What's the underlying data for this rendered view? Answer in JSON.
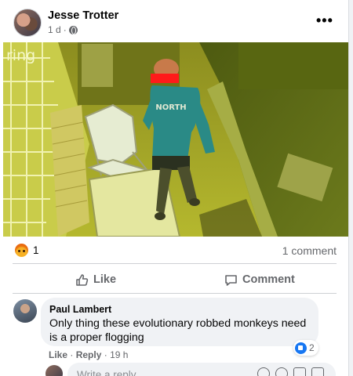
{
  "post": {
    "author": "Jesse Trotter",
    "time": "1 d",
    "separator": "·",
    "privacy_icon": "globe-icon",
    "more_icon": "more-options-icon",
    "more_label": "•••"
  },
  "photo": {
    "watermark": "ring",
    "jacket_text": "NORTH"
  },
  "stats": {
    "reaction_icon": "angry-reaction-icon",
    "reaction_count": "1",
    "comments_text": "1 comment"
  },
  "actions": {
    "like_label": "Like",
    "like_icon": "thumbs-up-icon",
    "comment_label": "Comment",
    "comment_icon": "speech-bubble-icon"
  },
  "comment": {
    "author": "Paul Lambert",
    "text": "Only thing these evolutionary robbed monkeys need is a proper flogging",
    "like_action": "Like",
    "reply_action": "Reply",
    "time": "19 h",
    "reaction_count": "2",
    "reaction_icon": "like-reaction-icon"
  },
  "reply": {
    "placeholder": "Write a reply..."
  },
  "colors": {
    "brand_blue": "#1877f2",
    "secondary_text": "#65676b",
    "bubble_bg": "#f0f2f5",
    "angry_orange": "#e9710f"
  }
}
